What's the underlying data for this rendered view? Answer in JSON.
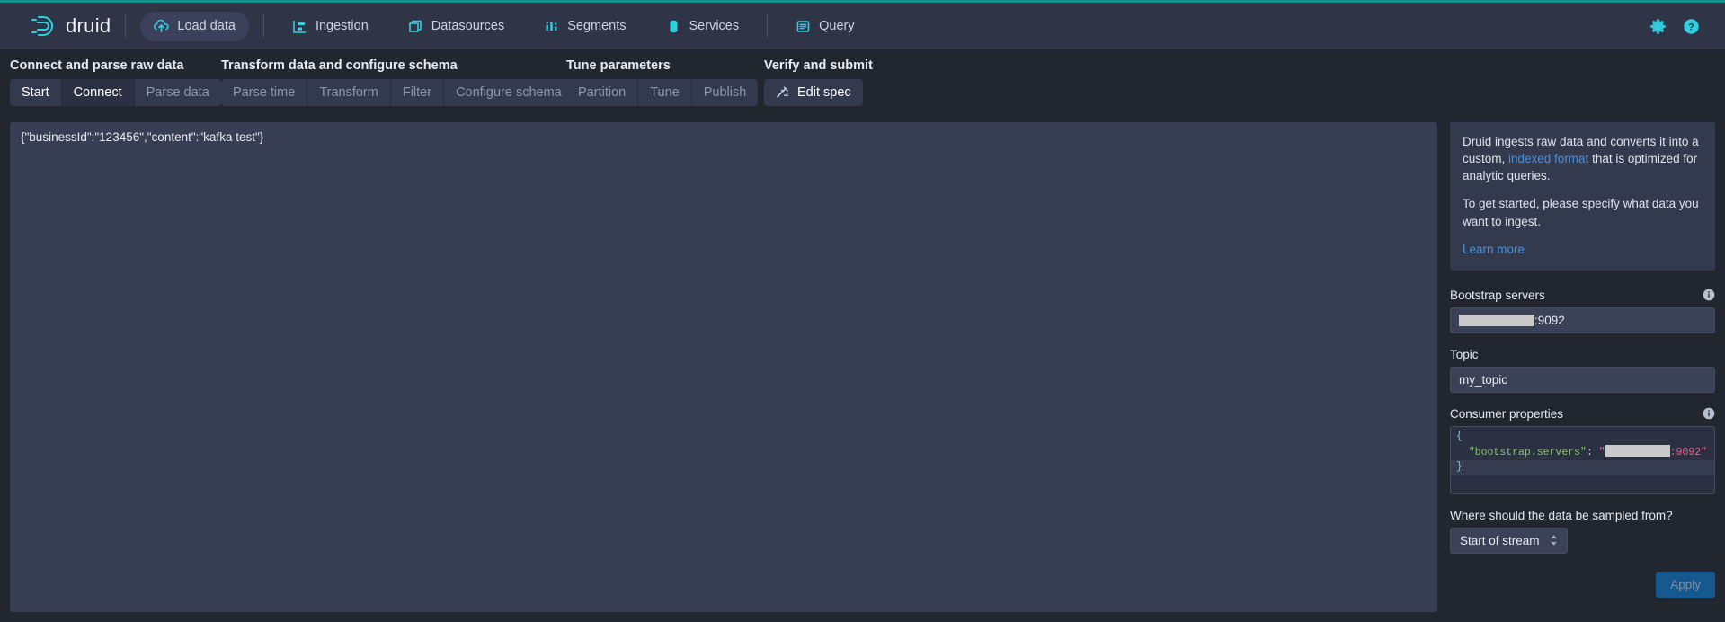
{
  "header": {
    "logo_text": "druid",
    "logo_icon": "druid-logo-icon",
    "nav": [
      {
        "label": "Load data",
        "icon": "upload-cloud-icon",
        "active": true
      },
      {
        "label": "Ingestion",
        "icon": "ingestion-icon",
        "active": false
      },
      {
        "label": "Datasources",
        "icon": "datasources-icon",
        "active": false
      },
      {
        "label": "Segments",
        "icon": "segments-icon",
        "active": false
      },
      {
        "label": "Services",
        "icon": "services-icon",
        "active": false
      },
      {
        "label": "Query",
        "icon": "query-icon",
        "active": false
      }
    ],
    "gear_icon": "gear-icon",
    "help_icon": "help-circle-icon"
  },
  "steps": {
    "sections": [
      {
        "title": "Connect and parse raw data"
      },
      {
        "title": "Transform data and configure schema"
      },
      {
        "title": "Tune parameters"
      },
      {
        "title": "Verify and submit"
      }
    ],
    "groups": [
      {
        "buttons": [
          {
            "label": "Start",
            "state": "on"
          },
          {
            "label": "Connect",
            "state": "cur"
          },
          {
            "label": "Parse data",
            "state": "off"
          }
        ]
      },
      {
        "buttons": [
          {
            "label": "Parse time",
            "state": "off"
          },
          {
            "label": "Transform",
            "state": "off"
          },
          {
            "label": "Filter",
            "state": "off"
          },
          {
            "label": "Configure schema",
            "state": "off"
          }
        ]
      },
      {
        "buttons": [
          {
            "label": "Partition",
            "state": "off"
          },
          {
            "label": "Tune",
            "state": "off"
          },
          {
            "label": "Publish",
            "state": "off"
          }
        ]
      },
      {
        "buttons": [
          {
            "label": "Edit spec",
            "state": "on",
            "icon": "magic-wand-icon"
          }
        ]
      }
    ]
  },
  "main": {
    "rows": [
      "{\"businessId\":\"123456\",\"content\":\"kafka test\"}"
    ]
  },
  "sidebar": {
    "info": {
      "para1_a": "Druid ingests raw data and converts it into a custom, ",
      "link1": "indexed format",
      "para1_b": " that is optimized for analytic queries.",
      "para2": "To get started, please specify what data you want to ingest.",
      "learn_more": "Learn more"
    },
    "bootstrap": {
      "label": "Bootstrap servers",
      "info_icon": "info-circle-icon",
      "value_suffix": ":9092",
      "value_redacted": true
    },
    "topic": {
      "label": "Topic",
      "value": "my_topic",
      "placeholder": "Topic"
    },
    "consumer_properties": {
      "label": "Consumer properties",
      "info_icon": "info-circle-icon",
      "line_open": "{",
      "key": "\"bootstrap.servers\"",
      "colon": ": ",
      "quote_open": "\"",
      "port": ":9092",
      "quote_close": "\"",
      "line_close": "}"
    },
    "sample_from": {
      "label": "Where should the data be sampled from?",
      "value": "Start of stream"
    },
    "apply_label": "Apply"
  },
  "colors": {
    "accent_teal": "#1c8d8d",
    "nav_icon": "#31d0e0",
    "link": "#4a90d9",
    "apply_bg": "#15598e",
    "panel": "#383e54",
    "header_bg": "#2f3447"
  }
}
